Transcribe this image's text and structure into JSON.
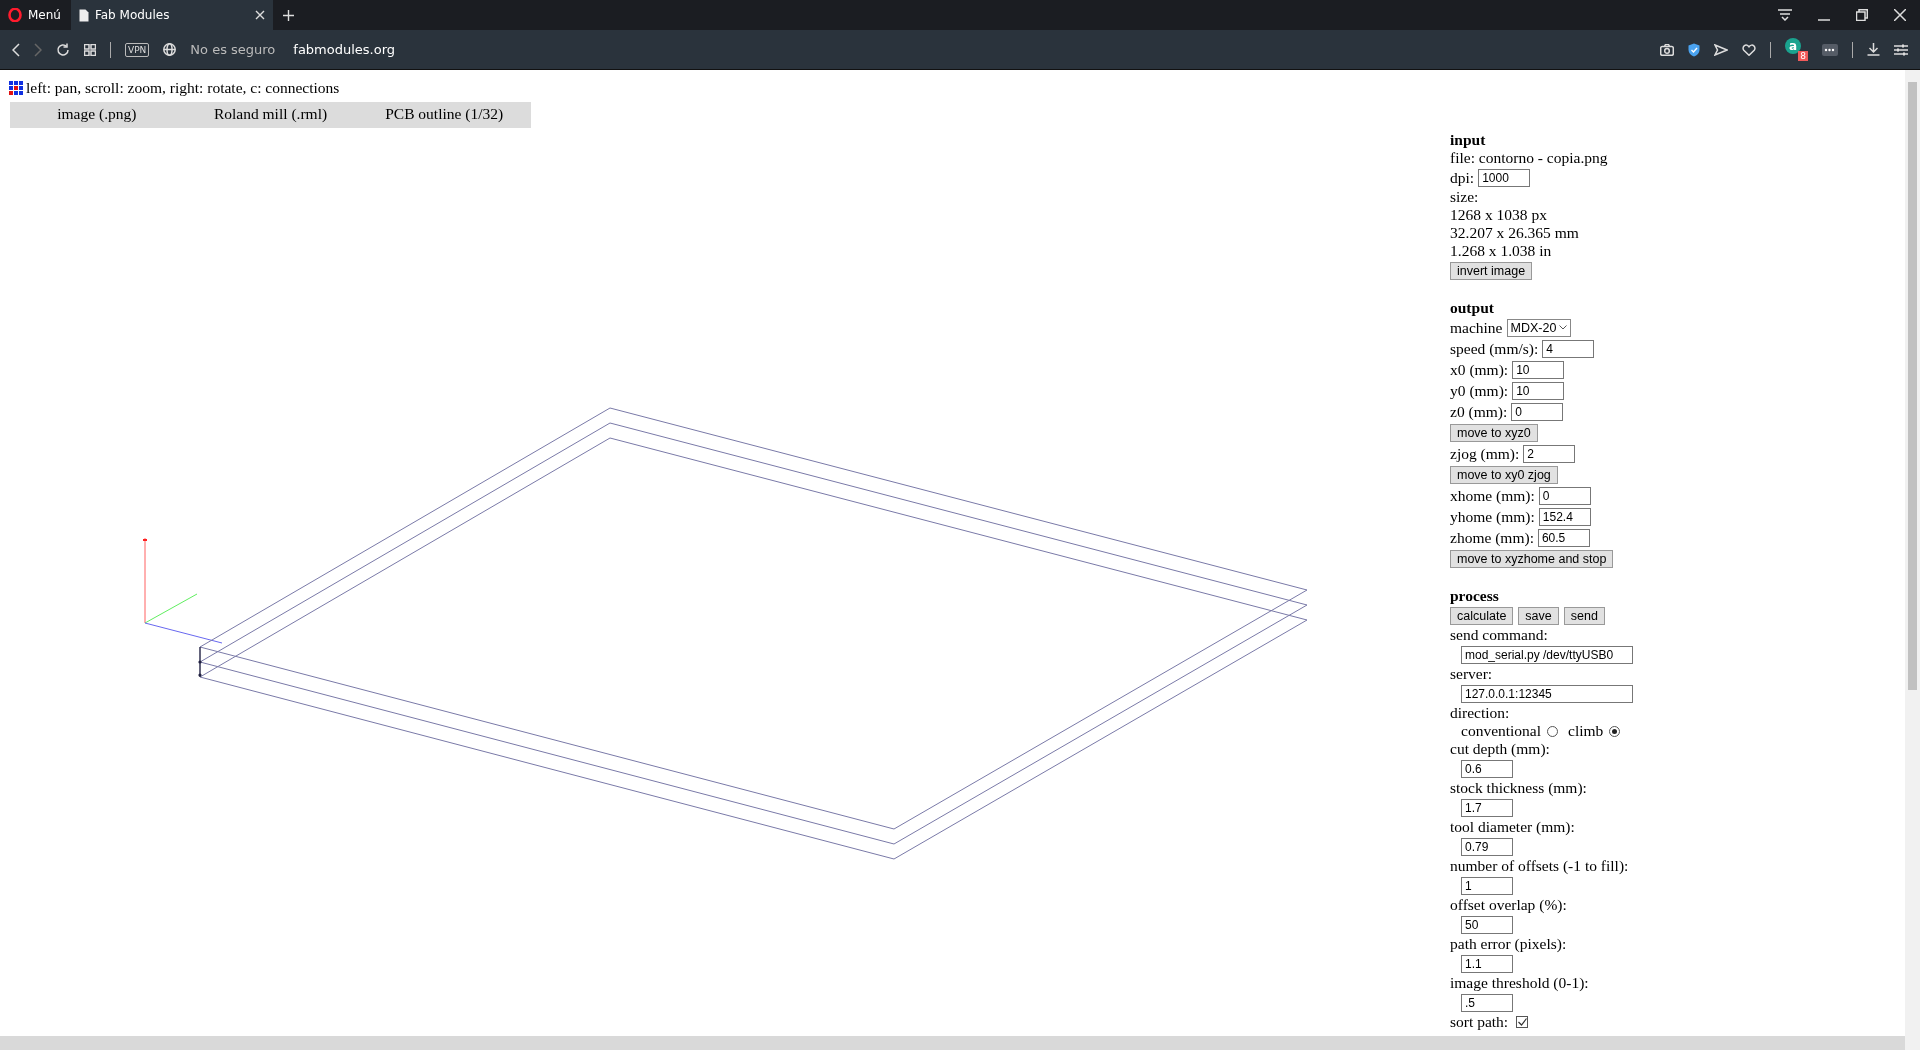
{
  "browser": {
    "menu_label": "Menú",
    "tabs": [
      {
        "label": "Fab Modules",
        "selected": true
      }
    ],
    "vpn_label": "VPN",
    "security": "No es seguro",
    "url": "fabmodules.org",
    "extension_letter": "a",
    "extension_badge": "8"
  },
  "hint": "left: pan, scroll: zoom, right: rotate, c: connections",
  "menu": [
    {
      "label": "image (.png)"
    },
    {
      "label": "Roland mill (.rml)"
    },
    {
      "label": "PCB outline (1/32)"
    }
  ],
  "panel": [
    {
      "kind": "heading",
      "text": "input"
    },
    {
      "kind": "text",
      "text": "file: contorno - copia.png"
    },
    {
      "kind": "field",
      "label": "dpi:",
      "value": "1000"
    },
    {
      "kind": "text",
      "text": "size:"
    },
    {
      "kind": "text",
      "text": "1268 x 1038 px"
    },
    {
      "kind": "text",
      "text": "32.207 x 26.365 mm"
    },
    {
      "kind": "text",
      "text": "1.268 x 1.038 in"
    },
    {
      "kind": "buttons",
      "buttons": [
        "invert image"
      ]
    },
    {
      "kind": "heading",
      "text": "output"
    },
    {
      "kind": "select",
      "label": "machine",
      "value": "MDX-20"
    },
    {
      "kind": "field",
      "label": "speed (mm/s):",
      "value": "4"
    },
    {
      "kind": "field",
      "label": "x0 (mm):",
      "value": "10"
    },
    {
      "kind": "field",
      "label": "y0 (mm):",
      "value": "10"
    },
    {
      "kind": "field",
      "label": "z0 (mm):",
      "value": "0"
    },
    {
      "kind": "buttons",
      "buttons": [
        "move to xyz0"
      ]
    },
    {
      "kind": "field",
      "label": "zjog (mm):",
      "value": "2"
    },
    {
      "kind": "buttons",
      "buttons": [
        "move to xy0 zjog"
      ]
    },
    {
      "kind": "field",
      "label": "xhome (mm):",
      "value": "0"
    },
    {
      "kind": "field",
      "label": "yhome (mm):",
      "value": "152.4"
    },
    {
      "kind": "field",
      "label": "zhome (mm):",
      "value": "60.5"
    },
    {
      "kind": "buttons",
      "buttons": [
        "move to xyzhome and stop"
      ]
    },
    {
      "kind": "heading",
      "text": "process"
    },
    {
      "kind": "buttons",
      "buttons": [
        "calculate",
        "save",
        "send"
      ]
    },
    {
      "kind": "text",
      "text": "send command:"
    },
    {
      "kind": "wide_input",
      "value": "mod_serial.py /dev/ttyUSB0"
    },
    {
      "kind": "text",
      "text": "server:"
    },
    {
      "kind": "wide_input",
      "value": "127.0.0.1:12345"
    },
    {
      "kind": "text",
      "text": "direction:"
    },
    {
      "kind": "radio",
      "options": [
        {
          "label": "conventional",
          "selected": false
        },
        {
          "label": "climb",
          "selected": true
        }
      ]
    },
    {
      "kind": "text",
      "text": "cut depth (mm):"
    },
    {
      "kind": "input",
      "value": "0.6"
    },
    {
      "kind": "text",
      "text": "stock thickness (mm):"
    },
    {
      "kind": "input",
      "value": "1.7"
    },
    {
      "kind": "text",
      "text": "tool diameter (mm):"
    },
    {
      "kind": "input",
      "value": "0.79"
    },
    {
      "kind": "text",
      "text": "number of offsets (-1 to fill):"
    },
    {
      "kind": "input",
      "value": "1"
    },
    {
      "kind": "text",
      "text": "offset overlap (%):"
    },
    {
      "kind": "input",
      "value": "50"
    },
    {
      "kind": "text",
      "text": "path error (pixels):"
    },
    {
      "kind": "input",
      "value": "1.1"
    },
    {
      "kind": "text",
      "text": "image threshold (0-1):"
    },
    {
      "kind": "input",
      "value": ".5"
    },
    {
      "kind": "checkbox",
      "label": "sort path:",
      "checked": true
    }
  ]
}
